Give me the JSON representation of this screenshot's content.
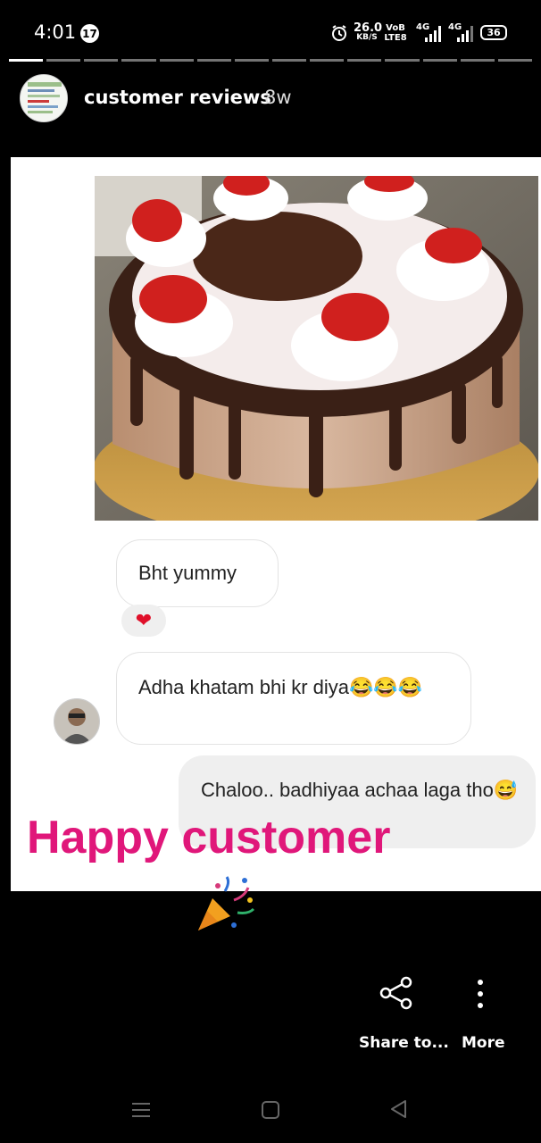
{
  "status_bar": {
    "time": "4:01",
    "notification_count": "17",
    "net_speed_value": "26.0",
    "net_speed_unit": "KB/S",
    "volte_top": "VoB",
    "volte_bottom": "LTE8",
    "sim1_label": "4G",
    "sim2_label": "4G",
    "battery": "36"
  },
  "story": {
    "segment_count": 14,
    "active_segment_index": 0,
    "account_name": "customer reviews",
    "age": "8w"
  },
  "chat": {
    "message_1": "Bht yummy",
    "reaction": "❤",
    "message_2": "Adha khatam bhi kr diya😂😂😂",
    "message_3": "Chaloo.. badhiyaa achaa laga tho😅"
  },
  "caption": "Happy customer",
  "party_emoji": "🎉",
  "actions": {
    "share_label": "Share to...",
    "more_label": "More"
  },
  "colors": {
    "caption": "#e0177a",
    "heart": "#e0102a"
  }
}
